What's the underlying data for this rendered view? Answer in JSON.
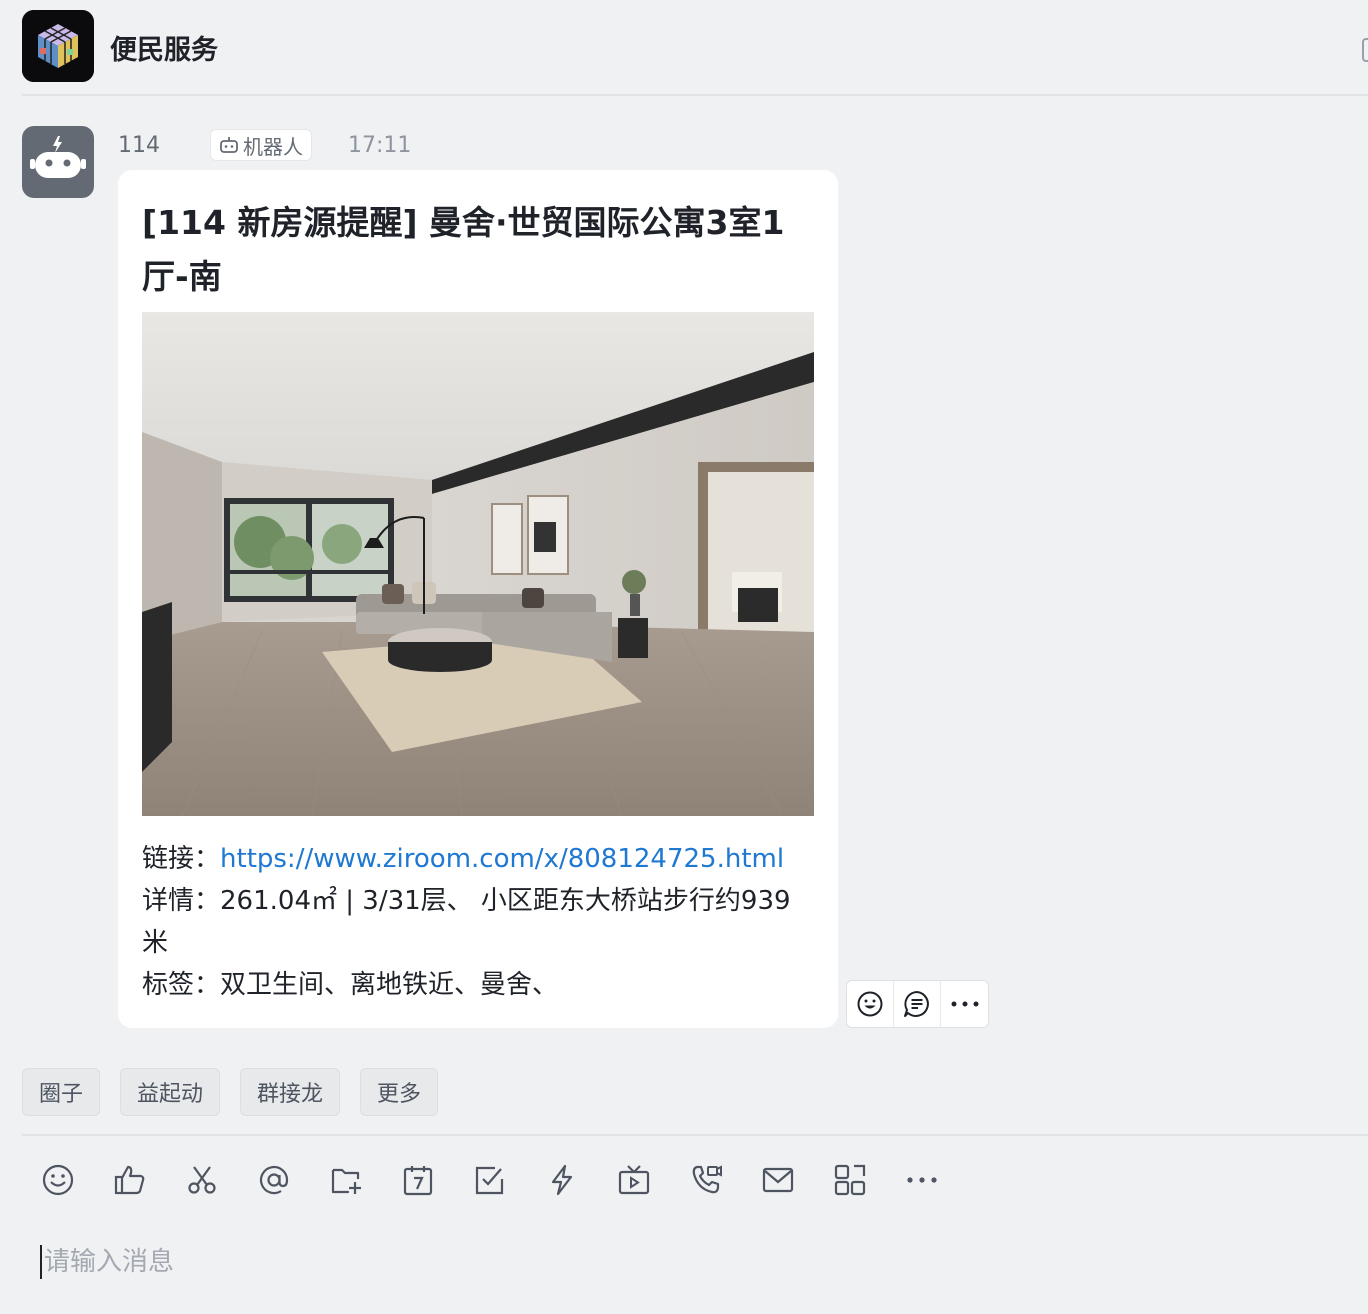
{
  "header": {
    "title": "便民服务",
    "avatar_icon": "rubiks-cube-icon"
  },
  "message": {
    "sender": "114",
    "badge_label": "机器人",
    "time": "17:11",
    "avatar_icon": "robot-icon",
    "card": {
      "title": "[114 新房源提醒] 曼舍·世贸国际公寓3室1厅-南",
      "image_alt": "living-room-photo",
      "link_label": "链接：",
      "link_url": "https://www.ziroom.com/x/808124725.html",
      "details_label": "详情：",
      "details_value": "261.04㎡ | 3/31层、 小区距东大桥站步行约939米",
      "tags_label": "标签：",
      "tags_value": "双卫生间、离地铁近、曼舍、"
    },
    "actions": [
      "emoji-reaction-icon",
      "reply-thread-icon",
      "more-icon"
    ]
  },
  "quick_apps": [
    "圈子",
    "益起动",
    "群接龙",
    "更多"
  ],
  "toolbar": [
    "emoji-icon",
    "thumbs-up-icon",
    "scissors-icon",
    "at-icon",
    "folder-add-icon",
    "calendar-icon",
    "task-checkbox-icon",
    "lightning-icon",
    "live-tv-icon",
    "video-call-icon",
    "mail-icon",
    "apps-grid-icon",
    "more-icon"
  ],
  "composer": {
    "placeholder": "请输入消息"
  },
  "colors": {
    "background": "#f0f1f3",
    "link": "#1f78d1",
    "bot_avatar": "#646a73"
  }
}
